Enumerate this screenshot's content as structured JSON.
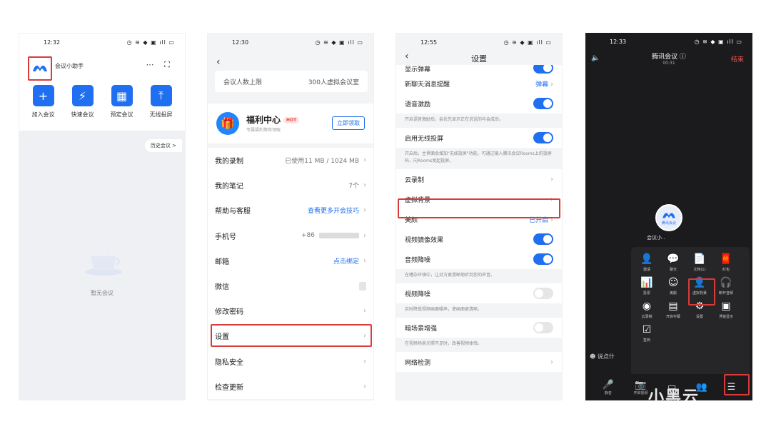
{
  "phone1": {
    "time": "12:32",
    "status_icons": "◷ ≋ ◆ ▣ ıll ▭",
    "assistant_name": "会议小助手",
    "quick_actions": [
      {
        "icon": "+",
        "label": "加入会议"
      },
      {
        "icon": "⚡",
        "label": "快速会议"
      },
      {
        "icon": "▦",
        "label": "预定会议"
      },
      {
        "icon": "⤒",
        "label": "无线投屏"
      }
    ],
    "history_label": "历史会议 >",
    "empty_text": "暂无会议"
  },
  "phone2": {
    "time": "12:30",
    "status_icons": "◷ ≋ ◆ ▣ ıll ▭",
    "meeting_limit_label": "会议人数上限",
    "meeting_limit_value": "300人虚拟会议室",
    "welfare_title": "福利中心",
    "hot_label": "HOT",
    "welfare_sub": "专属福利等你领取",
    "claim_label": "立即领取",
    "menu": [
      {
        "label": "我的录制",
        "value": "已使用11 MB / 1024 MB",
        "blue": false
      },
      {
        "label": "我的笔记",
        "value": "7个",
        "blue": false
      },
      {
        "label": "帮助与客服",
        "value": "查看更多开会技巧",
        "blue": true
      },
      {
        "label": "手机号",
        "value": "+86",
        "blue": false
      },
      {
        "label": "邮箱",
        "value": "点击绑定",
        "blue": true
      },
      {
        "label": "微信",
        "value": "",
        "blue": false
      },
      {
        "label": "修改密码",
        "value": "",
        "blue": false
      },
      {
        "label": "设置",
        "value": "",
        "blue": false
      },
      {
        "label": "隐私安全",
        "value": "",
        "blue": false
      },
      {
        "label": "检查更新",
        "value": "",
        "blue": false
      }
    ]
  },
  "phone3": {
    "time": "12:55",
    "status_icons": "◷ ≋ ◆ ▣ ıll ▭",
    "title": "设置",
    "cut_row_label": "显示弹幕",
    "new_chat_label": "新聊天消息提醒",
    "new_chat_value": "弹幕",
    "voice_label": "语音激励",
    "voice_desc": "开启语音激励后，会优先显示正在说话的与会成员。",
    "wireless_label": "启用无线投屏",
    "wireless_desc": "开启后，主界面会增加\"无线投屏\"功能，可通过输入腾讯会议Rooms上的投屏码，向Rooms发起投屏。",
    "cloud_label": "云录制",
    "virtual_bg_label": "虚拟背景",
    "beauty_label": "美颜",
    "beauty_value": "已开启",
    "mirror_label": "视频镜像效果",
    "audio_noise_label": "音频降噪",
    "audio_noise_desc": "在嘈杂环境中，让对方更清晰地听到您的声音。",
    "video_noise_label": "视频降噪",
    "video_noise_desc": "实时降低视频画面噪声，使画面更清晰。",
    "dark_label": "暗场景增强",
    "dark_desc": "在视频场景光照不足时，改善视频体验。",
    "network_label": "网络检测"
  },
  "phone4": {
    "time": "12:33",
    "status_icons": "◷ ≋ ◆ ▣ ıll ▭",
    "title": "腾讯会议 ⓘ",
    "duration": "00:31",
    "end_label": "结束",
    "avatar_text": "腾讯会议",
    "avatar_name": "会议小..",
    "panel_items": [
      {
        "icon": "👤",
        "label": "邀请"
      },
      {
        "icon": "💬",
        "label": "聊天"
      },
      {
        "icon": "📄",
        "label": "文档(1)"
      },
      {
        "icon": "🧧",
        "label": "红包"
      },
      {
        "icon": "",
        "label": ""
      },
      {
        "icon": "📊",
        "label": "投票"
      },
      {
        "icon": "☺",
        "label": "美颜"
      },
      {
        "icon": "👤",
        "label": "虚拟背景"
      },
      {
        "icon": "🎧",
        "label": "断开音频"
      },
      {
        "icon": "",
        "label": ""
      },
      {
        "icon": "◉",
        "label": "云录制"
      },
      {
        "icon": "▤",
        "label": "开启字幕"
      },
      {
        "icon": "⚙",
        "label": "设置"
      },
      {
        "icon": "▣",
        "label": "浮窗显示"
      },
      {
        "icon": "",
        "label": ""
      },
      {
        "icon": "☑",
        "label": "签到"
      }
    ],
    "say_label": "☻  说点什",
    "bottom_items": [
      {
        "icon": "🎤",
        "label": "静音"
      },
      {
        "icon": "📷",
        "label": "开启视频"
      },
      {
        "icon": "▭",
        "label": ""
      },
      {
        "icon": "👥",
        "label": ""
      },
      {
        "icon": "☰",
        "label": ""
      }
    ]
  },
  "watermark": "小黑云"
}
